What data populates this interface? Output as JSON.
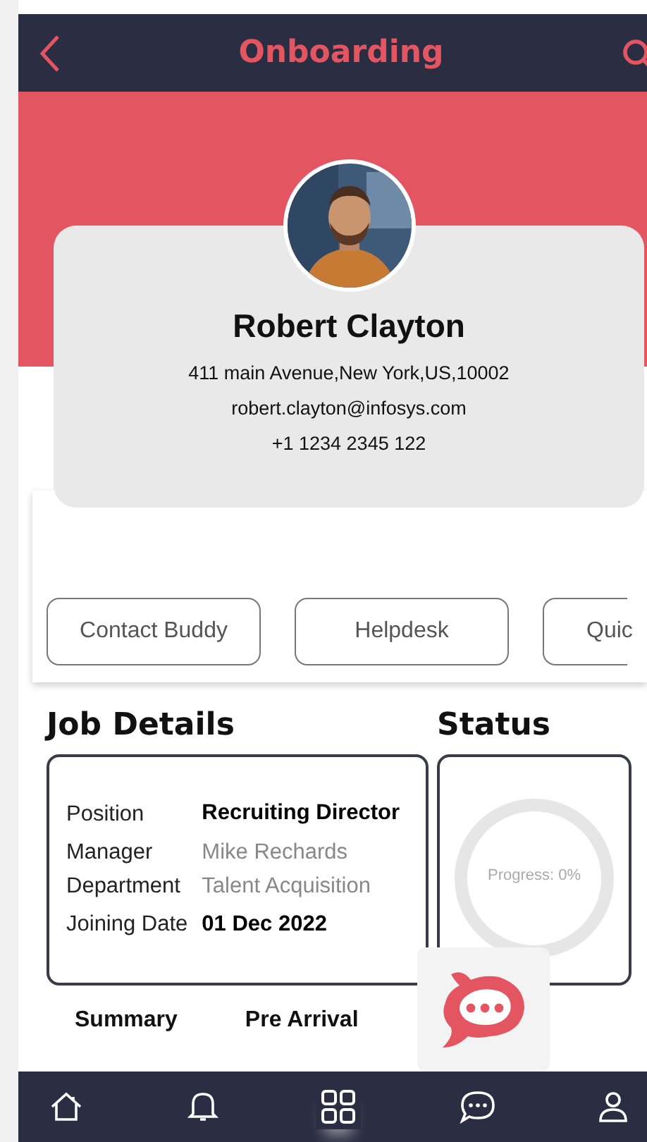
{
  "header": {
    "title": "Onboarding"
  },
  "profile": {
    "name": "Robert Clayton",
    "address": "411 main Avenue,New York,US,10002",
    "email": "robert.clayton@infosys.com",
    "phone": "+1 1234 2345 122"
  },
  "quick_actions": [
    {
      "label": "Contact Buddy"
    },
    {
      "label": "Helpdesk"
    },
    {
      "label": "Quic"
    }
  ],
  "job_details": {
    "title": "Job Details",
    "rows": [
      {
        "label": "Position",
        "value": "Recruiting Director",
        "kind": "emphasis"
      },
      {
        "label": "Manager",
        "value": "Mike Rechards",
        "kind": "muted"
      },
      {
        "label": "Department",
        "value": "Talent Acquisition",
        "kind": "muted"
      },
      {
        "label": "Joining Date",
        "value": "01 Dec 2022",
        "kind": "emphasis"
      }
    ]
  },
  "status": {
    "title": "Status",
    "progress_label": "Progress: 0%",
    "level": 0
  },
  "section_tabs": [
    {
      "label": "Summary"
    },
    {
      "label": "Pre Arrival"
    }
  ],
  "bottom_nav": [
    {
      "kind": "home",
      "selected": false
    },
    {
      "kind": "bell",
      "selected": false
    },
    {
      "kind": "grid",
      "selected": true
    },
    {
      "kind": "chat",
      "selected": false
    },
    {
      "kind": "profile",
      "selected": false
    }
  ]
}
